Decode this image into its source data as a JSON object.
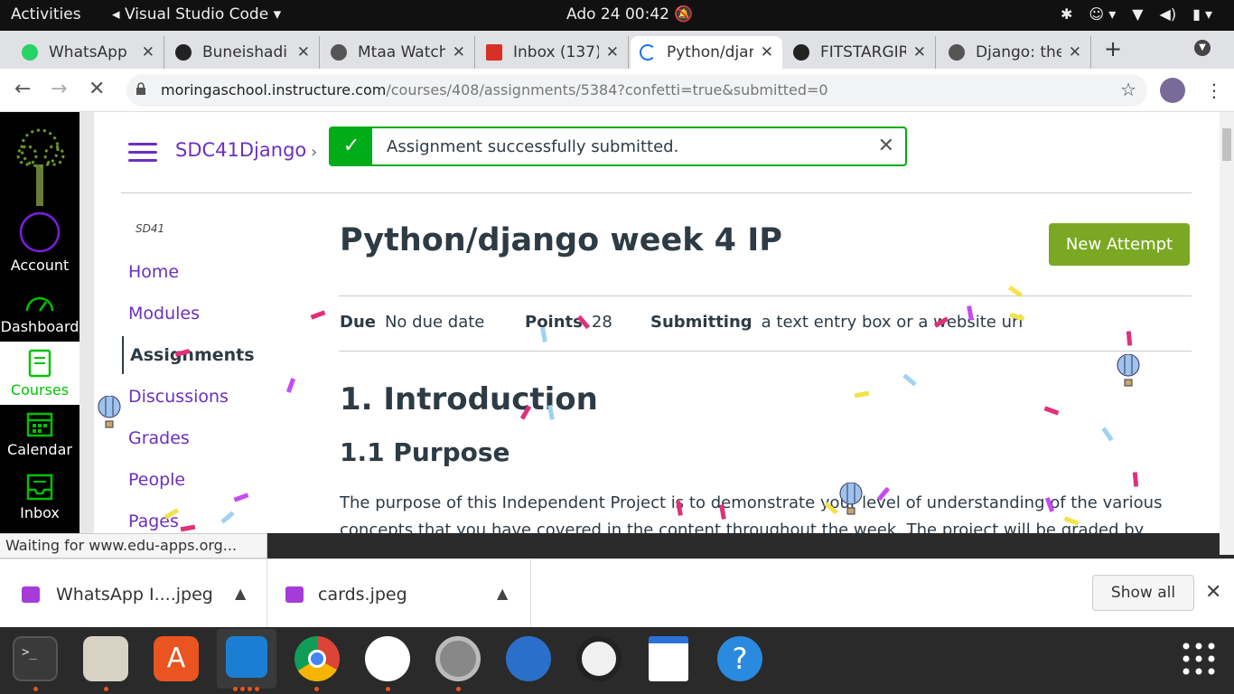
{
  "topbar": {
    "activities": "Activities",
    "app": "Visual Studio Code",
    "clock": "Ado 24  00:42"
  },
  "tabs": [
    {
      "title": "WhatsApp",
      "color": "#25d366"
    },
    {
      "title": "Buneishadi",
      "color": "#222222"
    },
    {
      "title": "Mtaa Watch",
      "color": "#555555"
    },
    {
      "title": "Inbox (137)",
      "color": "#d93025"
    },
    {
      "title": "Python/django",
      "color": "#1a73e8"
    },
    {
      "title": "FITSTARGIRL",
      "color": "#222222"
    },
    {
      "title": "Django: the",
      "color": "#555555"
    }
  ],
  "address": {
    "host": "moringaschool.instructure.com",
    "path": "/courses/408/assignments/5384?confetti=true&submitted=0"
  },
  "global_nav": [
    {
      "label": "Account",
      "icon": "account-icon"
    },
    {
      "label": "Dashboard",
      "icon": "dashboard-icon"
    },
    {
      "label": "Courses",
      "icon": "courses-icon"
    },
    {
      "label": "Calendar",
      "icon": "calendar-icon"
    },
    {
      "label": "Inbox",
      "icon": "inbox-icon"
    }
  ],
  "breadcrumb": {
    "course": "SDC41Django"
  },
  "toast": {
    "message": "Assignment successfully submitted."
  },
  "course_nav": {
    "code": "SD41",
    "items": [
      "Home",
      "Modules",
      "Assignments",
      "Discussions",
      "Grades",
      "People",
      "Pages"
    ],
    "active": "Assignments"
  },
  "assignment": {
    "title": "Python/django week 4 IP",
    "new_attempt": "New Attempt",
    "due_label": "Due",
    "due_value": "No due date",
    "points_label": "Points",
    "points_value": "28",
    "submitting_label": "Submitting",
    "submitting_value": "a text entry box or a website url",
    "h1": "1. Introduction",
    "h2": "1.1 Purpose",
    "para": "The purpose of this Independent Project is to demonstrate your level of understanding of the various concepts that you have covered in the content throughout the week. The project will be graded by your TM and will determine if you are eligible to move on to the next module. All the requirements provided"
  },
  "status_text": "Waiting for www.edu-apps.org...",
  "downloads": [
    {
      "name": "WhatsApp I....jpeg"
    },
    {
      "name": "cards.jpeg"
    }
  ],
  "download_shelf": {
    "show_all": "Show all"
  },
  "colors": {
    "canvas_purple": "#6b2fbf",
    "success_green": "#00ac18",
    "new_attempt_green": "#7aa823",
    "canvas_active_green": "#00c200"
  }
}
